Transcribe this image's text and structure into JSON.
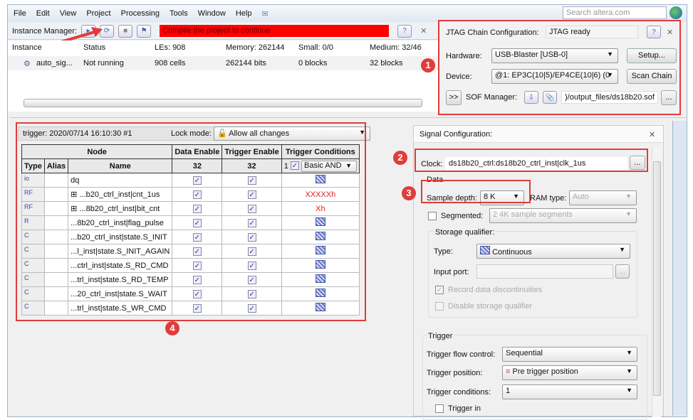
{
  "menu": [
    "File",
    "Edit",
    "View",
    "Project",
    "Processing",
    "Tools",
    "Window",
    "Help"
  ],
  "search_placeholder": "Search altera.com",
  "instance_manager": {
    "label": "Instance Manager:",
    "status_message": "Compile the project to continue",
    "headers": [
      "Instance",
      "Status",
      "LEs: 908",
      "Memory: 262144",
      "Small: 0/0",
      "Medium: 32/46"
    ],
    "row": [
      "auto_sig...",
      "Not running",
      "908 cells",
      "262144 bits",
      "0 blocks",
      "32 blocks"
    ]
  },
  "jtag": {
    "label": "JTAG Chain Configuration:",
    "status": "JTAG ready",
    "hardware_label": "Hardware:",
    "hardware": "USB-Blaster [USB-0]",
    "setup": "Setup...",
    "device_label": "Device:",
    "device": "@1: EP3C(10|5)/EP4CE(10|6) (0",
    "scan_chain": "Scan Chain",
    "expand": ">>",
    "sof_label": "SOF Manager:",
    "sof_path": ")/output_files/ds18b20.sof",
    "browse": "..."
  },
  "trigger_tab": {
    "title": "trigger: 2020/07/14 16:10:30  #1",
    "lock_label": "Lock mode:",
    "lock_value": "Allow all changes"
  },
  "table": {
    "node": "Node",
    "data_enable": "Data Enable",
    "trigger_enable": "Trigger Enable",
    "trigger_conditions": "Trigger Conditions",
    "type": "Type",
    "alias": "Alias",
    "name": "Name",
    "data_count": "32",
    "trigger_count": "32",
    "cond_index": "1",
    "cond_mode": "Basic AND",
    "rows": [
      {
        "type": "io",
        "name": "dq",
        "cond": ""
      },
      {
        "type": "RF",
        "name": "...b20_ctrl_inst|cnt_1us",
        "cond": "XXXXXh",
        "expand": "⊞"
      },
      {
        "type": "RF",
        "name": "...8b20_ctrl_inst|bit_cnt",
        "cond": "Xh",
        "expand": "⊞"
      },
      {
        "type": "R",
        "name": "...8b20_ctrl_inst|flag_pulse",
        "cond": ""
      },
      {
        "type": "C",
        "name": "...b20_ctrl_inst|state.S_INIT",
        "cond": ""
      },
      {
        "type": "C",
        "name": "...l_inst|state.S_INIT_AGAIN",
        "cond": ""
      },
      {
        "type": "C",
        "name": "...ctrl_inst|state.S_RD_CMD",
        "cond": ""
      },
      {
        "type": "C",
        "name": "...trl_inst|state.S_RD_TEMP",
        "cond": ""
      },
      {
        "type": "C",
        "name": "...20_ctrl_inst|state.S_WAIT",
        "cond": ""
      },
      {
        "type": "C",
        "name": "...trl_inst|state.S_WR_CMD",
        "cond": ""
      }
    ]
  },
  "signal": {
    "title": "Signal Configuration:",
    "clock_label": "Clock:",
    "clock": "ds18b20_ctrl:ds18b20_ctrl_inst|clk_1us",
    "data": "Data",
    "sample_label": "Sample depth:",
    "sample": "8 K",
    "ram_label": "RAM type:",
    "ram": "Auto",
    "segmented": "Segmented:",
    "segments": "2  4K sample segments",
    "storage": "Storage qualifier:",
    "type_label": "Type:",
    "type": "Continuous",
    "input_label": "Input port:",
    "record": "Record data discontinuities",
    "disable": "Disable storage qualifier",
    "trigger": "Trigger",
    "flow_label": "Trigger flow control:",
    "flow": "Sequential",
    "pos_label": "Trigger position:",
    "pos": "Pre trigger position",
    "cond_label": "Trigger conditions:",
    "cond": "1",
    "trigger_in": "Trigger in"
  },
  "badges": [
    "1",
    "2",
    "3",
    "4"
  ],
  "colors": {
    "annotation": "#e03c3c",
    "status_bar": "#ff0000",
    "cond_text": "#e02020"
  }
}
